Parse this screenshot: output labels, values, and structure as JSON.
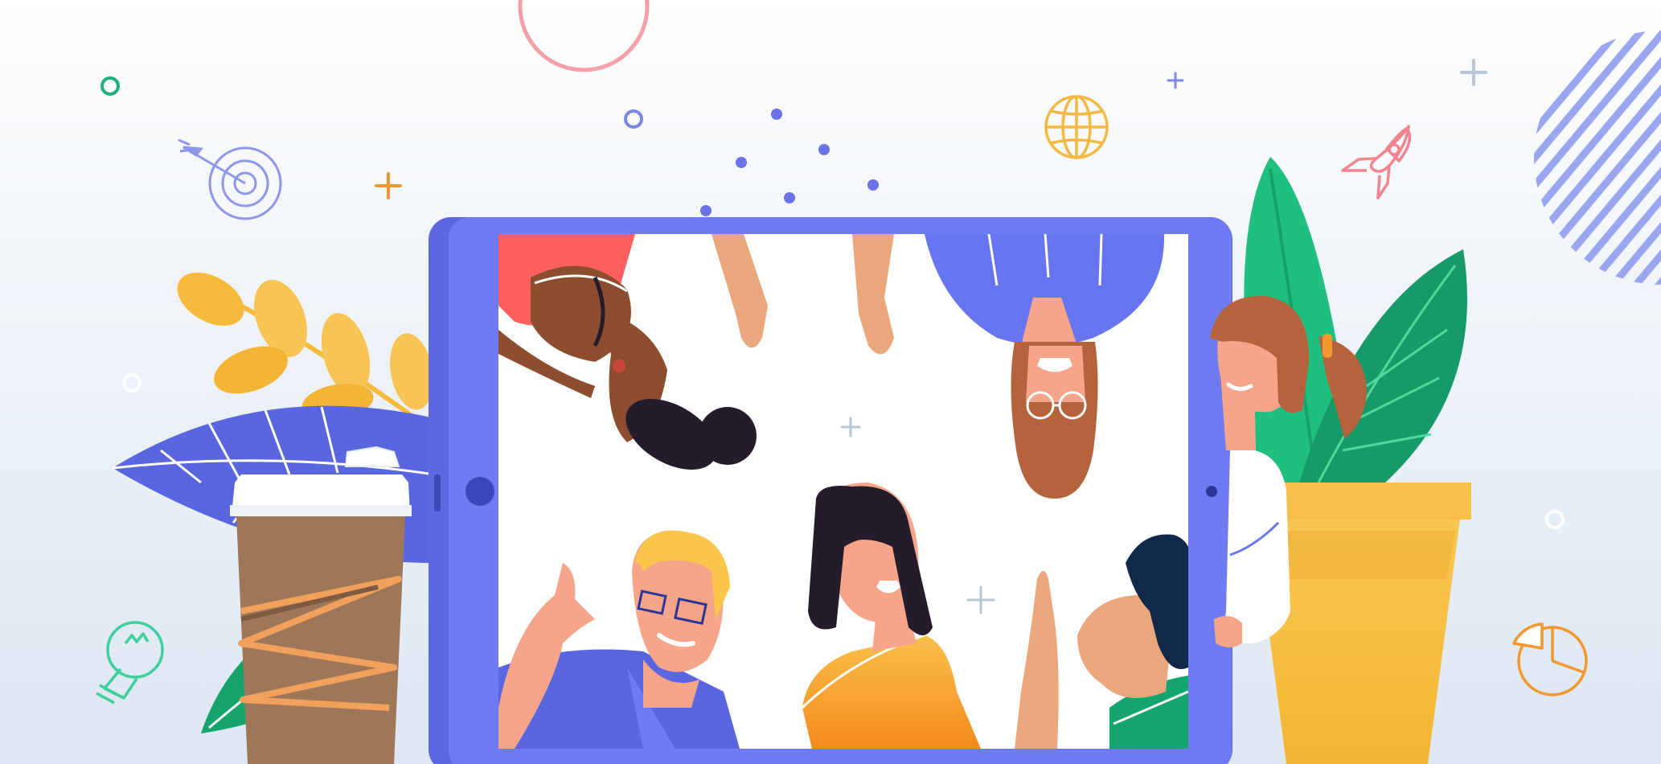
{
  "scene": {
    "title": "",
    "description_text": "",
    "colors": {
      "background_top": "#ffffff",
      "background_bottom": "#dbe5f1",
      "tablet_frame": "#5c67e0",
      "tablet_frame_light": "#6f7bf2",
      "screen": "#ffffff",
      "leaf_blue": "#5a66df",
      "leaf_green": "#1fbf7f",
      "leaf_dark_green": "#169a67",
      "wheat_yellow": "#f6bb3c",
      "pot_yellow": "#f7c04a",
      "coffee_brown": "#9e7658",
      "coffee_accent": "#f2a15c",
      "skin_light": "#f6a58a",
      "skin_medium": "#eba77c",
      "skin_dark": "#8d4e2f",
      "hair_black": "#241c2b",
      "hair_brown": "#b4633d",
      "hair_blonde": "#fcc64b",
      "shirt_orange": "#f7a33a",
      "shirt_blue": "#6775f0",
      "shirt_green": "#14a56f",
      "shirt_red": "#ff5f5f",
      "deco_pink": "#f5a0a8",
      "deco_orange": "#f2962f",
      "deco_purple": "#7e86e6",
      "deco_green": "#2fcf91"
    },
    "icons": [
      "target-icon",
      "globe-icon",
      "rocket-icon",
      "lightbulb-icon",
      "pie-chart-icon"
    ],
    "people_count": 7
  }
}
